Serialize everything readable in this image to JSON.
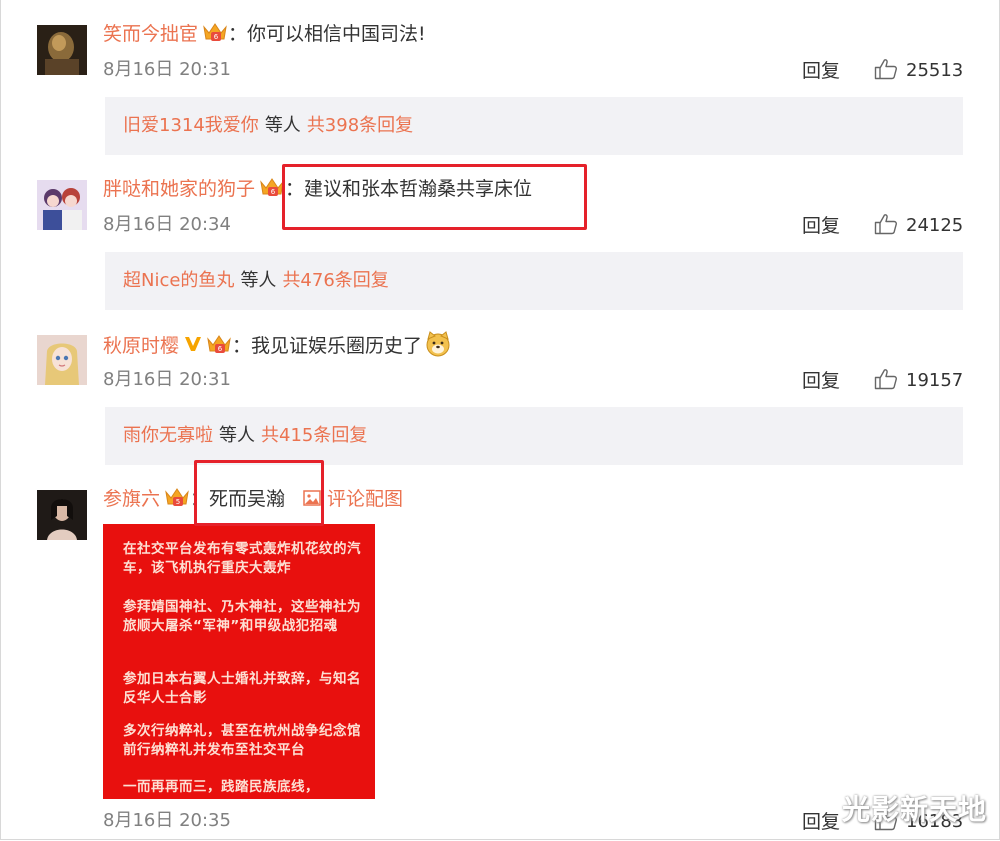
{
  "comments": [
    {
      "user": "笑而今拙宦",
      "text": "你可以相信中国司法!",
      "time": "8月16日 20:31",
      "reply_label": "回复",
      "likes": "25513",
      "reply_summary": {
        "user": "旧爱1314我爱你",
        "mid": "等人",
        "count": "共398条回复"
      }
    },
    {
      "user": "胖哒和她家的狗子",
      "text": "建议和张本哲瀚桑共享床位",
      "time": "8月16日 20:34",
      "reply_label": "回复",
      "likes": "24125",
      "reply_summary": {
        "user": "超Nice的鱼丸",
        "mid": "等人",
        "count": "共476条回复"
      }
    },
    {
      "user": "秋原时樱",
      "text": "我见证娱乐圈历史了",
      "time": "8月16日 20:31",
      "reply_label": "回复",
      "likes": "19157",
      "reply_summary": {
        "user": "雨你无寡啦",
        "mid": "等人",
        "count": "共415条回复"
      }
    },
    {
      "user": "参旗六",
      "text": "死而吴瀚",
      "pic_link": "评论配图",
      "time": "8月16日 20:35",
      "reply_label": "回复",
      "likes": "16183"
    }
  ],
  "image_text": [
    "在社交平台发布有零式轰炸机花纹的汽车，该飞机执行重庆大轰炸",
    "参拜靖国神社、乃木神社，这些神社为旅顺大屠杀“军神”和甲级战犯招魂",
    "参加日本右翼人士婚礼并致辞，与知名反华人士合影",
    "多次行纳粹礼，甚至在杭州战争纪念馆前行纳粹礼并发布至社交平台",
    "一而再再而三，践踏民族底线，"
  ],
  "watermark": "光影新天地",
  "colors": {
    "username": "#eb7350",
    "highlight": "#e5212a",
    "reply_bg": "#f2f2f5",
    "image_bg": "#e8100e"
  },
  "icons": [
    "crown-badge-icon",
    "verified-v-icon",
    "thumbs-up-icon",
    "dog-emoji-icon",
    "picture-icon"
  ]
}
